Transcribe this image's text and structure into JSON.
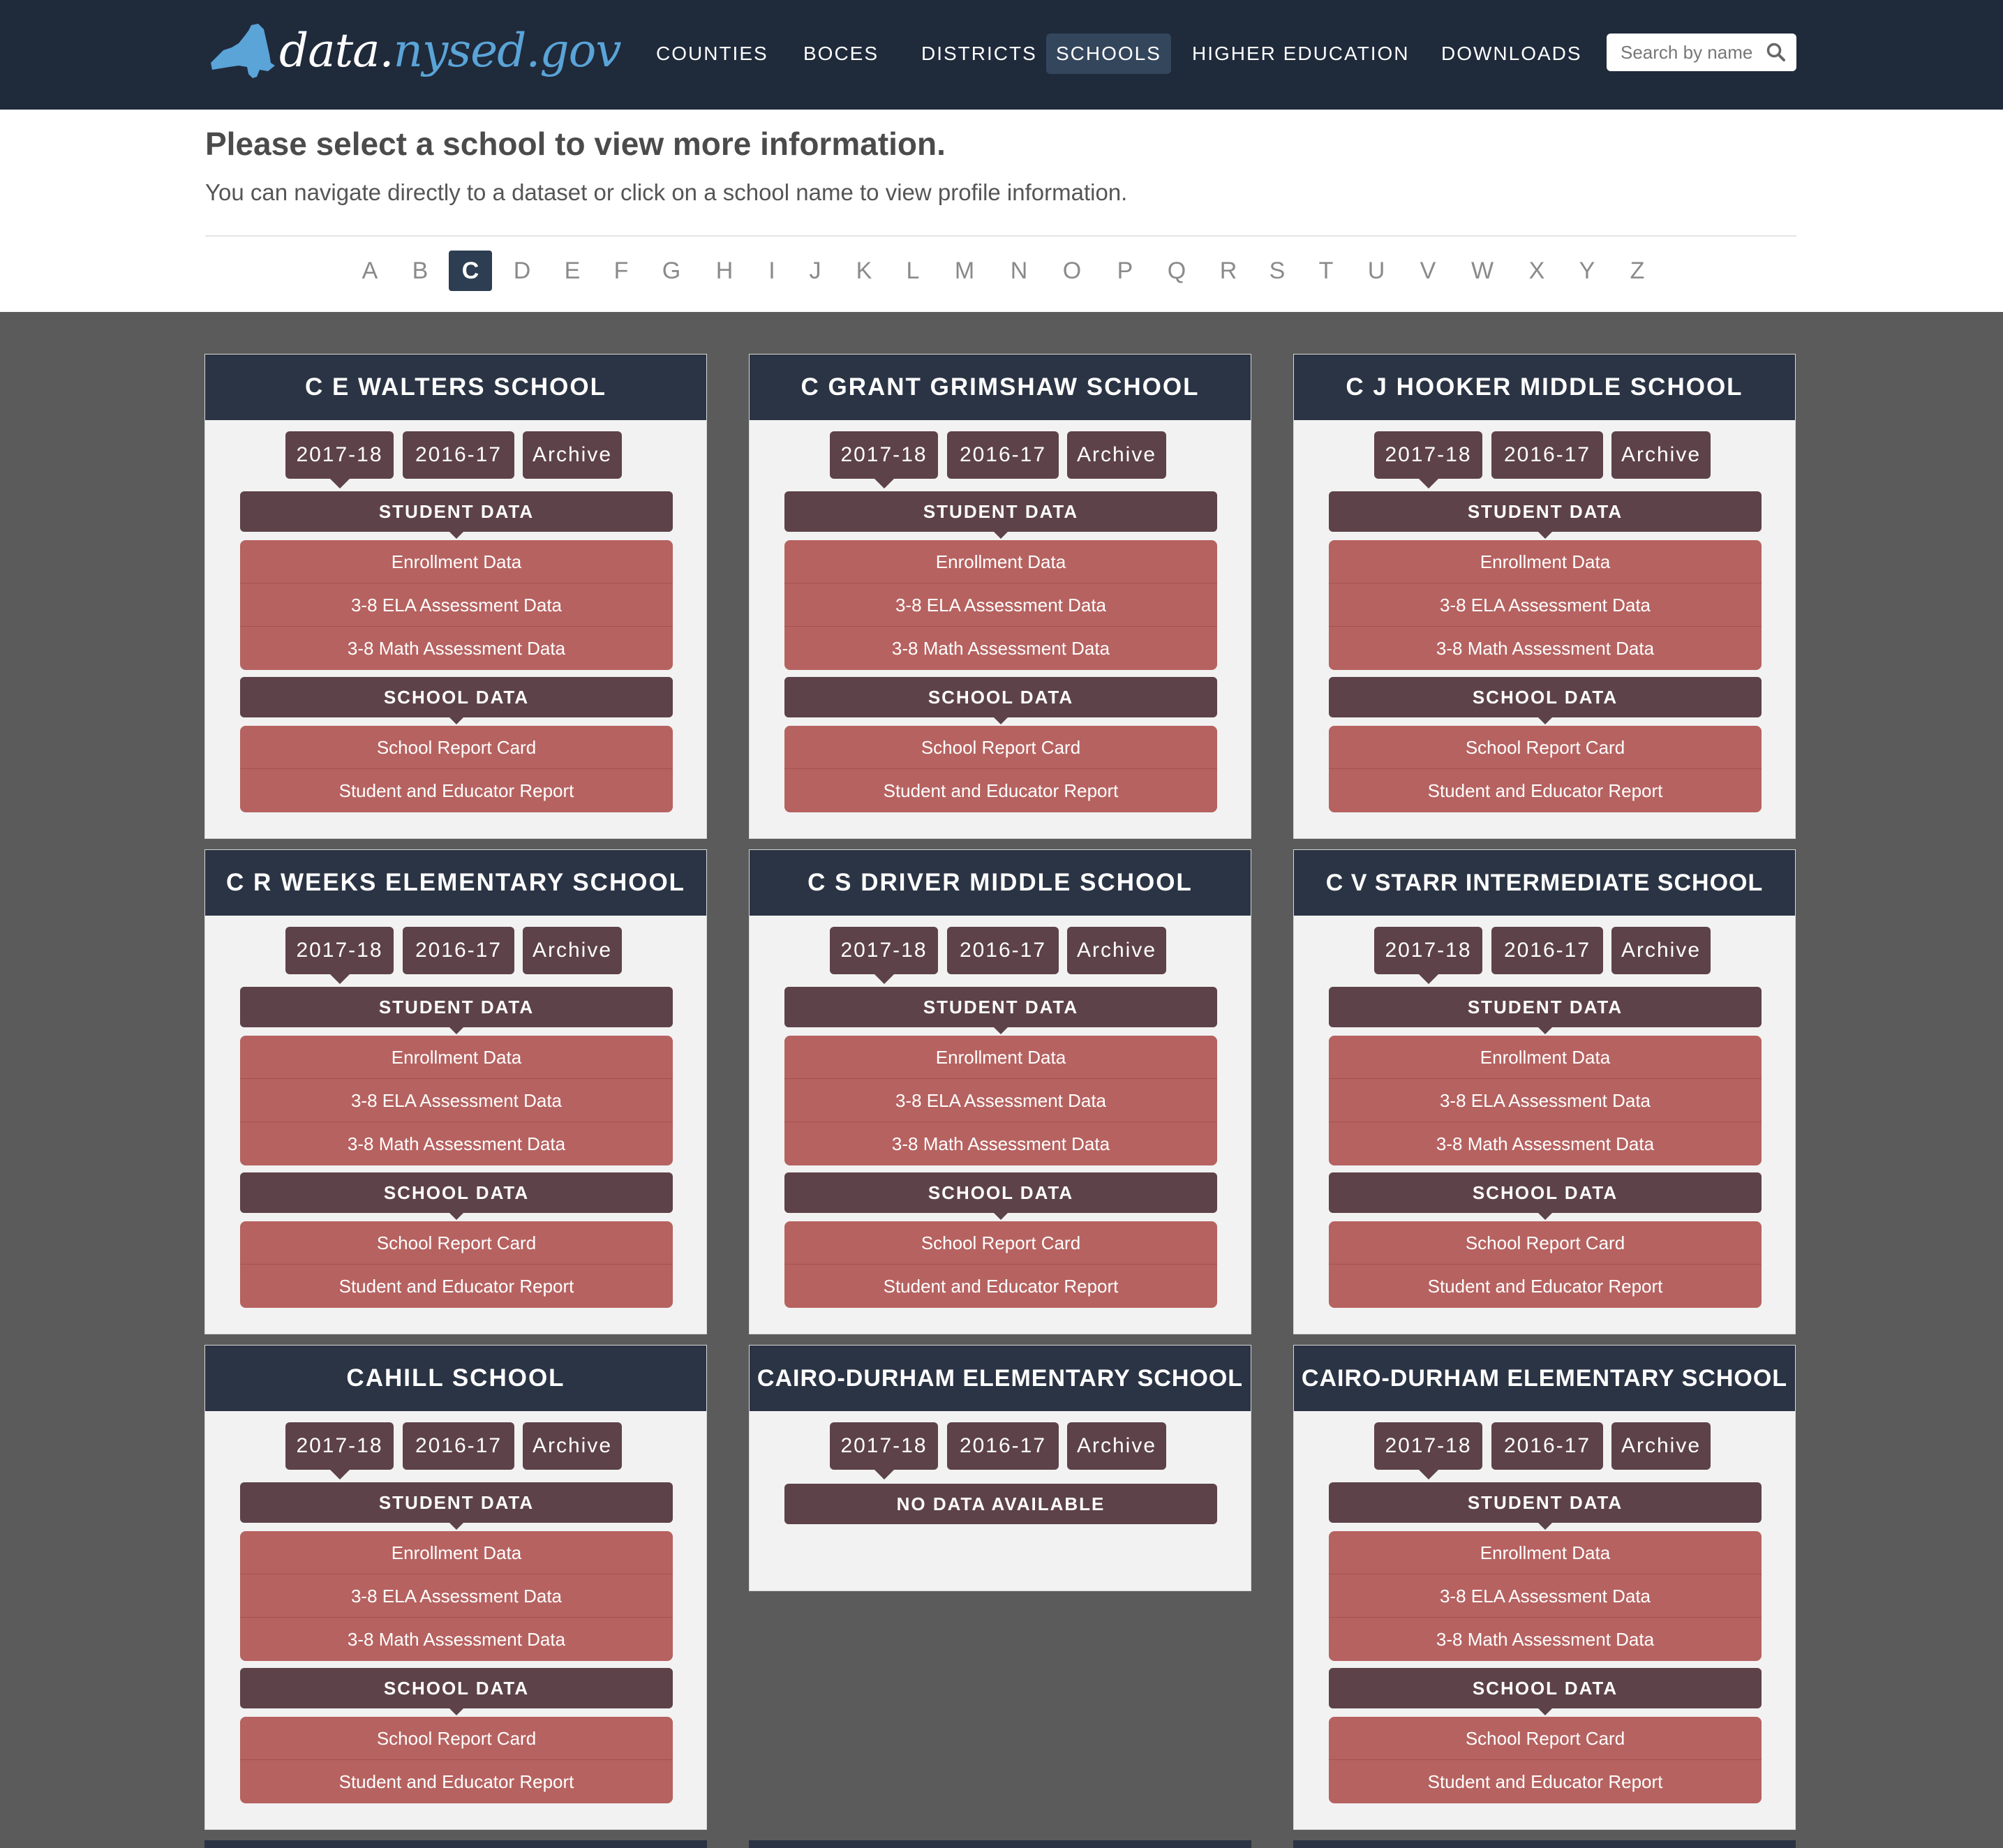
{
  "brand": {
    "logo_white": "data.",
    "logo_blue": "nysed.gov"
  },
  "nav": {
    "items": [
      "COUNTIES",
      "BOCES",
      "DISTRICTS",
      "SCHOOLS",
      "HIGHER EDUCATION",
      "DOWNLOADS"
    ],
    "active": "SCHOOLS"
  },
  "search": {
    "placeholder": "Search by name",
    "icon": "search-icon"
  },
  "header": {
    "title": "Please select a school to view more information.",
    "subtitle": "You can navigate directly to a dataset or click on a school name to view profile information."
  },
  "alphabet": {
    "letters": [
      "A",
      "B",
      "C",
      "D",
      "E",
      "F",
      "G",
      "H",
      "I",
      "J",
      "K",
      "L",
      "M",
      "N",
      "O",
      "P",
      "Q",
      "R",
      "S",
      "T",
      "U",
      "V",
      "W",
      "X",
      "Y",
      "Z"
    ],
    "active": "C"
  },
  "labels": {
    "student_data": "STUDENT DATA",
    "school_data": "SCHOOL DATA",
    "no_data": "NO DATA AVAILABLE",
    "student_links": [
      "Enrollment Data",
      "3-8 ELA Assessment Data",
      "3-8 Math Assessment Data"
    ],
    "school_links": [
      "School Report Card",
      "Student and Educator Report"
    ]
  },
  "years": [
    "2017-18",
    "2016-17",
    "Archive"
  ],
  "schools": [
    {
      "name": "C E WALTERS SCHOOL",
      "has_data": true
    },
    {
      "name": "C GRANT GRIMSHAW SCHOOL",
      "has_data": true
    },
    {
      "name": "C J HOOKER MIDDLE SCHOOL",
      "has_data": true
    },
    {
      "name": "C R WEEKS ELEMENTARY SCHOOL",
      "has_data": true
    },
    {
      "name": "C S DRIVER MIDDLE SCHOOL",
      "has_data": true
    },
    {
      "name": "C V STARR INTERMEDIATE SCHOOL",
      "has_data": true
    },
    {
      "name": "CAHILL SCHOOL",
      "has_data": true
    },
    {
      "name": "CAIRO-DURHAM ELEMENTARY SCHOOL",
      "has_data": false
    },
    {
      "name": "CAIRO-DURHAM ELEMENTARY SCHOOL",
      "has_data": true
    }
  ],
  "colors": {
    "nav_bg": "#1f2a3b",
    "card_head": "#2b3444",
    "maroon": "#5d4249",
    "link_red": "#b66260",
    "page_bg": "#5b5b5b",
    "logo_blue": "#5aa4d8"
  }
}
